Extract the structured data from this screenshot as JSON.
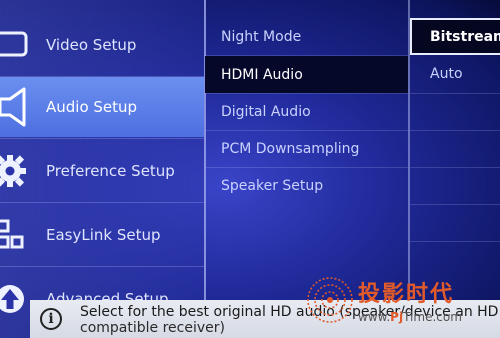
{
  "left_menu": {
    "items": [
      {
        "label": "Video Setup",
        "icon": "tv-icon",
        "selected": false
      },
      {
        "label": "Audio Setup",
        "icon": "speaker-icon",
        "selected": true
      },
      {
        "label": "Preference Setup",
        "icon": "gear-icon",
        "selected": false
      },
      {
        "label": "EasyLink Setup",
        "icon": "grid-icon",
        "selected": false
      },
      {
        "label": "Advanced Setup",
        "icon": "arrow-up-icon",
        "selected": false
      }
    ]
  },
  "middle_menu": {
    "items": [
      {
        "label": "Night Mode",
        "selected": false
      },
      {
        "label": "HDMI Audio",
        "selected": true
      },
      {
        "label": "Digital Audio",
        "selected": false
      },
      {
        "label": "PCM Downsampling",
        "selected": false
      },
      {
        "label": "Speaker Setup",
        "selected": false
      }
    ]
  },
  "right_options": {
    "items": [
      {
        "label": "Bitstream",
        "selected": true
      },
      {
        "label": "Auto",
        "selected": false
      }
    ]
  },
  "info_bar": {
    "line1": "Select for the best original HD audio (speaker/device an HD",
    "line2": "compatible receiver)"
  },
  "watermark": {
    "chinese": "投影时代",
    "url_prefix": "www.",
    "url_brand": "Pj",
    "url_suffix": "Time.com"
  },
  "colors": {
    "background": "#202a9a",
    "selected_left": "#5a7ee8",
    "selected_mid": "#06082a",
    "info_bar": "#e0e3ec",
    "watermark_accent": "#e05a2a"
  }
}
